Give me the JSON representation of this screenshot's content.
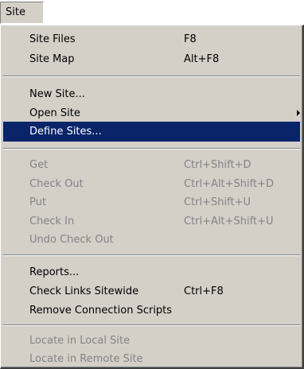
{
  "menubar": {
    "site_label": "Site"
  },
  "menu": {
    "items": [
      {
        "label": "Site Files",
        "shortcut": "F8"
      },
      {
        "label": "Site Map",
        "shortcut": "Alt+F8"
      },
      {
        "label": "New Site...",
        "shortcut": ""
      },
      {
        "label": "Open Site",
        "shortcut": ""
      },
      {
        "label": "Define Sites...",
        "shortcut": ""
      },
      {
        "label": "Get",
        "shortcut": "Ctrl+Shift+D"
      },
      {
        "label": "Check Out",
        "shortcut": "Ctrl+Alt+Shift+D"
      },
      {
        "label": "Put",
        "shortcut": "Ctrl+Shift+U"
      },
      {
        "label": "Check In",
        "shortcut": "Ctrl+Alt+Shift+U"
      },
      {
        "label": "Undo Check Out",
        "shortcut": ""
      },
      {
        "label": "Reports...",
        "shortcut": ""
      },
      {
        "label": "Check Links Sitewide",
        "shortcut": "Ctrl+F8"
      },
      {
        "label": "Remove Connection Scripts",
        "shortcut": ""
      },
      {
        "label": "Locate in Local Site",
        "shortcut": ""
      },
      {
        "label": "Locate in Remote Site",
        "shortcut": ""
      }
    ],
    "highlighted_item": "Define Sites...",
    "disabled_items": [
      "Get",
      "Check Out",
      "Put",
      "Check In",
      "Undo Check Out",
      "Locate in Local Site",
      "Locate in Remote Site"
    ],
    "submenu_items": [
      "Open Site"
    ]
  },
  "colors": {
    "menu_background": "#d4d0c8",
    "highlight_background": "#0a246a",
    "highlight_text": "#ffffff",
    "disabled_text": "#848284"
  }
}
